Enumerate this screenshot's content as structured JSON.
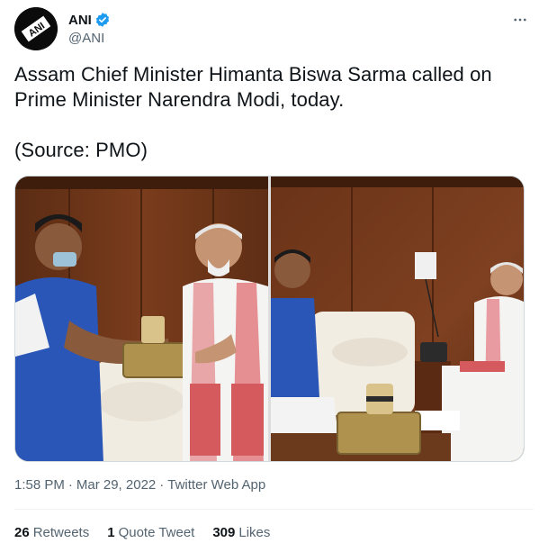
{
  "author": {
    "display_name": "ANI",
    "handle": "@ANI",
    "avatar_icon": "ani-logo-icon",
    "verified_icon": "verified-badge-icon",
    "verified_color": "#1d9bf0"
  },
  "menu": {
    "icon": "more-options-icon"
  },
  "tweet": {
    "text": "Assam Chief Minister Himanta Biswa Sarma called on Prime Minister Narendra Modi, today.\n\n(Source: PMO)"
  },
  "media": {
    "photos": [
      {
        "name": "photo-1"
      },
      {
        "name": "photo-2"
      }
    ]
  },
  "meta": {
    "time": "1:58 PM",
    "separator": "·",
    "date": "Mar 29, 2022",
    "client": "Twitter Web App"
  },
  "stats": {
    "retweets_count": "26",
    "retweets_label": "Retweets",
    "quote_count": "1",
    "quote_label": "Quote Tweet",
    "likes_count": "309",
    "likes_label": "Likes"
  },
  "colors": {
    "text_primary": "#0f1419",
    "text_secondary": "#536471",
    "border": "#cfd9de"
  }
}
